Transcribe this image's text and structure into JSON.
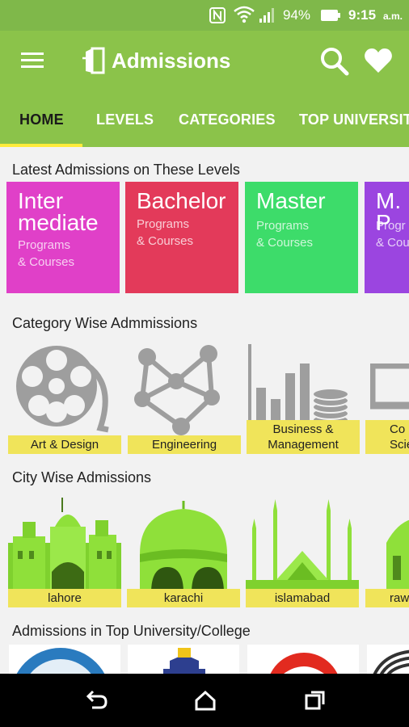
{
  "status_bar": {
    "battery_percent": "94%",
    "time": "9:15",
    "ampm": "a.m."
  },
  "app_bar": {
    "title": "Admissions"
  },
  "tabs": [
    {
      "label": "HOME",
      "active": true
    },
    {
      "label": "LEVELS",
      "active": false
    },
    {
      "label": "CATEGORIES",
      "active": false
    },
    {
      "label": "TOP UNIVERSITI",
      "active": false
    }
  ],
  "sections": {
    "levels_title": "Latest Admissions on These Levels",
    "categories_title": "Category Wise Admmissions",
    "cities_title": "City Wise Admissions",
    "universities_title": "Admissions in Top University/College"
  },
  "levels": [
    {
      "title_line1": "Inter",
      "title_line2": "mediate",
      "sub1": "Programs",
      "sub2": "& Courses",
      "color": "#e040c8"
    },
    {
      "title_line1": "Bachelor",
      "title_line2": "",
      "sub1": "Programs",
      "sub2": "& Courses",
      "color": "#e33a5a"
    },
    {
      "title_line1": "Master",
      "title_line2": "",
      "sub1": "Programs",
      "sub2": "& Courses",
      "color": "#3ddc6a"
    },
    {
      "title_line1": "M. P",
      "title_line2": "",
      "sub1": "Progr",
      "sub2": "& Cou",
      "color": "#9b45e0"
    }
  ],
  "categories": [
    {
      "label": "Art & Design",
      "icon": "film-reel-icon"
    },
    {
      "label": "Engineering",
      "icon": "network-icon"
    },
    {
      "label_line1": "Business &",
      "label_line2": "Management",
      "icon": "bar-chart-coins-icon"
    },
    {
      "label_line1": "Co",
      "label_line2": "Scie",
      "icon": "computer-icon"
    }
  ],
  "cities": [
    {
      "label": "lahore"
    },
    {
      "label": "karachi"
    },
    {
      "label": "islamabad"
    },
    {
      "label": "raw"
    }
  ],
  "colors": {
    "primary": "#8bc34a",
    "status_bar": "#7fb84a",
    "tab_indicator": "#ffeb3b",
    "card_label": "#f0e45a",
    "icon_gray": "#9e9e9e",
    "city_green": "#8fe03a"
  }
}
